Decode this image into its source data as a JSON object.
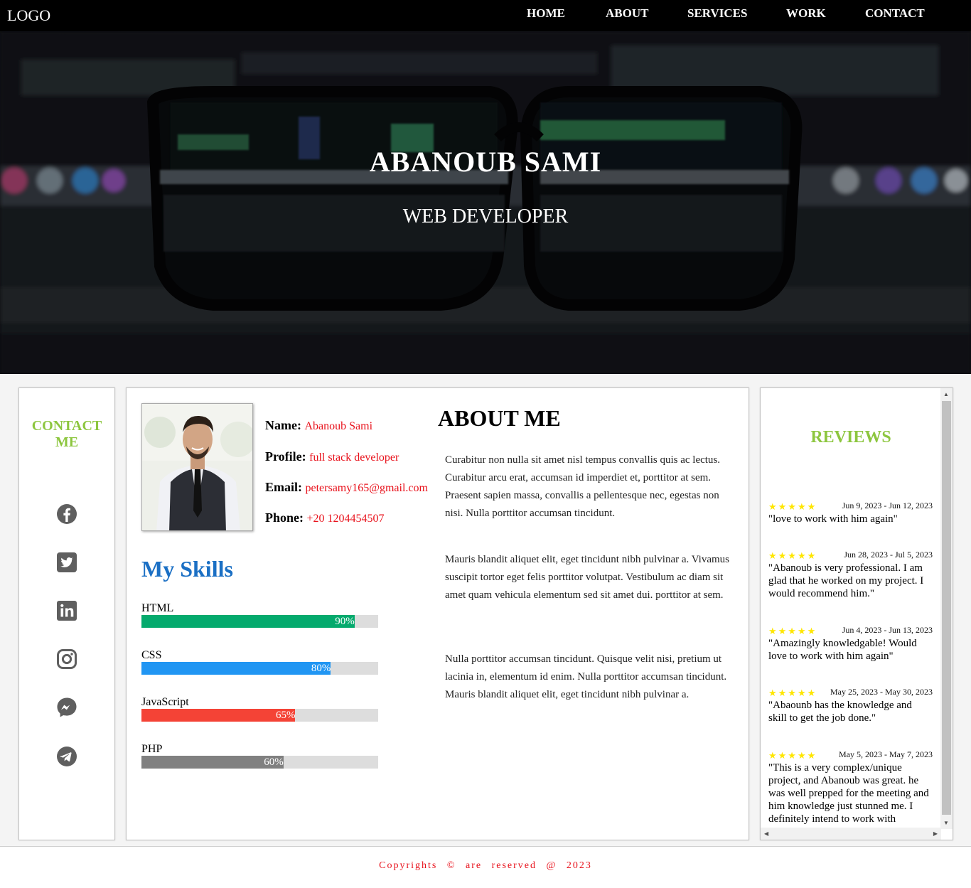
{
  "nav": {
    "logo": "LOGO",
    "items": [
      "HOME",
      "ABOUT",
      "SERVICES",
      "WORK",
      "CONTACT"
    ]
  },
  "hero": {
    "name": "ABANOUB SAMI",
    "role": "WEB DEVELOPER"
  },
  "contact": {
    "title": "CONTACT ME",
    "icons": [
      "facebook-icon",
      "twitter-icon",
      "linkedin-icon",
      "instagram-icon",
      "messenger-icon",
      "telegram-icon"
    ]
  },
  "profile": {
    "name_label": "Name:",
    "name_value": "Abanoub Sami",
    "profile_label": "Profile:",
    "profile_value": "full stack developer",
    "email_label": "Email:",
    "email_value": "petersamy165@gmail.com",
    "phone_label": "Phone:",
    "phone_value": "+20 1204454507"
  },
  "skills": {
    "title": "My Skills",
    "items": [
      {
        "name": "HTML",
        "level": 90,
        "level_text": "90%",
        "color": "#04aa6d"
      },
      {
        "name": "CSS",
        "level": 80,
        "level_text": "80%",
        "color": "#2196f3"
      },
      {
        "name": "JavaScript",
        "level": 65,
        "level_text": "65%",
        "color": "#f44336"
      },
      {
        "name": "PHP",
        "level": 60,
        "level_text": "60%",
        "color": "#808080"
      }
    ]
  },
  "about": {
    "title": "ABOUT ME",
    "paragraphs": [
      "Curabitur non nulla sit amet nisl tempus convallis quis ac lectus. Curabitur arcu erat, accumsan id imperdiet et, porttitor at sem. Praesent sapien massa, convallis a pellentesque nec, egestas non nisi. Nulla porttitor accumsan tincidunt.",
      "Mauris blandit aliquet elit, eget tincidunt nibh pulvinar a. Vivamus suscipit tortor eget felis porttitor volutpat. Vestibulum ac diam sit amet quam vehicula elementum sed sit amet dui. porttitor at sem.",
      "Nulla porttitor accumsan tincidunt. Quisque velit nisi, pretium ut lacinia in, elementum id enim. Nulla porttitor accumsan tincidunt. Mauris blandit aliquet elit, eget tincidunt nibh pulvinar a."
    ]
  },
  "reviews": {
    "title": "REVIEWS",
    "items": [
      {
        "stars": "★★★★★",
        "date": "Jun 9, 2023 - Jun 12, 2023",
        "text": "\"love to work with him again\""
      },
      {
        "stars": "★★★★★",
        "date": "Jun 28, 2023 - Jul 5, 2023",
        "text": "\"Abanoub is very professional. I am glad that he worked on my project. I would recommend him.\""
      },
      {
        "stars": "★★★★★",
        "date": "Jun 4, 2023 - Jun 13, 2023",
        "text": "\"Amazingly knowledgable! Would love to work with him again\""
      },
      {
        "stars": "★★★★★",
        "date": "May 25, 2023 - May 30, 2023",
        "text": "\"Abaounb has the knowledge and skill to get the job done.\""
      },
      {
        "stars": "★★★★★",
        "date": "May 5, 2023 - May 7, 2023",
        "text": "\"This is a very complex/unique project, and Abanoub was great. he was well prepped for the meeting and him knowledge just stunned me. I definitely intend to work with"
      }
    ]
  },
  "footer": {
    "text": "Copyrights © are reserved @ 2023"
  }
}
